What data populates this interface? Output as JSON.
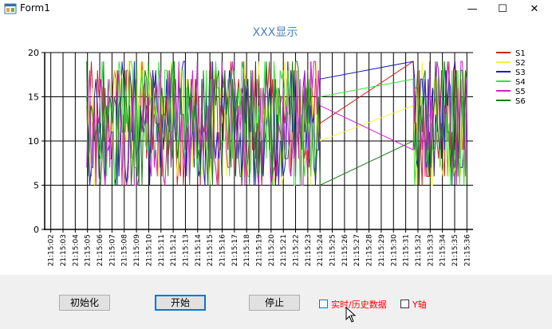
{
  "window": {
    "title": "Form1",
    "minimize": "—",
    "maximize": "☐",
    "close": "✕"
  },
  "chart_data": {
    "type": "line",
    "title": "XXX显示",
    "ylim": [
      0,
      20
    ],
    "yticks": [
      0,
      5,
      10,
      15,
      20
    ],
    "x": [
      "21:15:02",
      "21:15:03",
      "21:15:04",
      "21:15:05",
      "21:15:06",
      "21:15:07",
      "21:15:08",
      "21:15:09",
      "21:15:10",
      "21:15:11",
      "21:15:12",
      "21:15:13",
      "21:15:14",
      "21:15:15",
      "21:15:16",
      "21:15:17",
      "21:15:18",
      "21:15:19",
      "21:15:20",
      "21:15:21",
      "21:15:22",
      "21:15:23",
      "21:15:24",
      "21:15:25",
      "21:15:26",
      "21:15:27",
      "21:15:28",
      "21:15:29",
      "21:15:30",
      "21:15:31",
      "21:15:32",
      "21:15:33",
      "21:15:34",
      "21:15:35",
      "21:15:36"
    ],
    "grid": true,
    "legend_position": "right",
    "series": [
      {
        "name": "S1",
        "color": "#d42020"
      },
      {
        "name": "S2",
        "color": "#f4f43a"
      },
      {
        "name": "S3",
        "color": "#1e1eb4"
      },
      {
        "name": "S4",
        "color": "#38e038"
      },
      {
        "name": "S5",
        "color": "#d020d0"
      },
      {
        "name": "S6",
        "color": "#1e7a1e"
      }
    ],
    "dense_region_1": [
      "21:15:05",
      "21:15:24"
    ],
    "dense_region_2": [
      "21:15:32",
      "21:15:36"
    ],
    "value_range": [
      5,
      19
    ],
    "gap_lines": [
      {
        "series": "S1",
        "from": 12,
        "to": 19
      },
      {
        "series": "S2",
        "from": 10,
        "to": 14
      },
      {
        "series": "S3",
        "from": 17,
        "to": 19
      },
      {
        "series": "S4",
        "from": 15,
        "to": 17
      },
      {
        "series": "S5",
        "from": 14,
        "to": 9
      },
      {
        "series": "S6",
        "from": 5,
        "to": 10
      }
    ]
  },
  "controls": {
    "init_label": "初始化",
    "start_label": "开始",
    "stop_label": "停止",
    "realtime_history_label": "实时/历史数据",
    "y_axis_label": "Y轴"
  }
}
